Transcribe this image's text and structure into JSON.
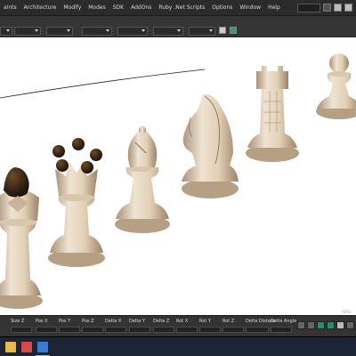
{
  "menu": {
    "items": [
      "aints",
      "Architecture",
      "Modify",
      "Modes",
      "SDK",
      "AddOns",
      "Ruby .Net Scripts",
      "Options",
      "Window",
      "Help"
    ]
  },
  "viewport": {
    "background": "#ffffff",
    "piece_color": "#e6d6bf",
    "piece_shadow": "#a88f73",
    "dark_color": "#3a2a1a",
    "pieces": [
      "king",
      "queen",
      "bishop",
      "knight",
      "rook",
      "pawn"
    ],
    "overlay_text": "MAE"
  },
  "coords": {
    "fields": [
      "Size Z",
      "Pos X",
      "Pos Y",
      "Pos Z",
      "Delta X",
      "Delta Y",
      "Delta Z",
      "Rot X",
      "Rot Y",
      "Rot Z",
      "Delta Distanc",
      "Delta Angle"
    ]
  },
  "colors": {
    "accent": "#2e8c6c",
    "taskbar": "#1c2533"
  }
}
